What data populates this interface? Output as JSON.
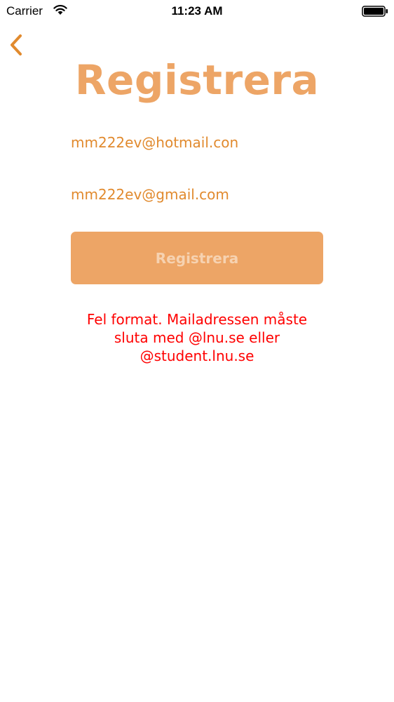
{
  "status_bar": {
    "carrier": "Carrier",
    "time": "11:23 AM",
    "wifi_icon": "wifi-icon",
    "battery_icon": "battery-icon"
  },
  "nav": {
    "back_icon": "chevron-left-icon"
  },
  "title": "Registrera",
  "form": {
    "email_1": "mm222ev@hotmail.con",
    "email_2": "mm222ev@gmail.com",
    "submit_label": "Registrera"
  },
  "error": {
    "line_1": "Fel format. Mailadressen måste",
    "line_2": "sluta med @lnu.se eller",
    "line_3": "@student.lnu.se"
  },
  "colors": {
    "accent": "#e18a2e",
    "title": "#eda566",
    "button_bg": "#eda566",
    "button_text": "#f6d2b1",
    "error": "#ff0000"
  }
}
